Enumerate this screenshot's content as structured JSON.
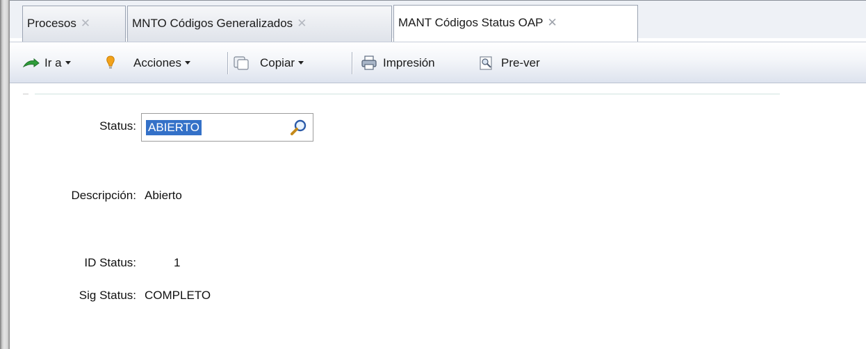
{
  "tabs": [
    {
      "label": "Procesos",
      "active": false
    },
    {
      "label": "MNTO Códigos Generalizados",
      "active": false
    },
    {
      "label": "MANT Códigos Status OAP",
      "active": true
    }
  ],
  "tab_close_glyph": "✕",
  "toolbar": {
    "goto_label": "Ir a",
    "actions_label": "Acciones",
    "copy_label": "Copiar",
    "print_label": "Impresión",
    "preview_label": "Pre-ver"
  },
  "form": {
    "status_label": "Status:",
    "status_value": "ABIERTO",
    "description_label": "Descripción:",
    "description_value": "Abierto",
    "id_status_label": "ID Status:",
    "id_status_value": "1",
    "next_status_label": "Sig Status:",
    "next_status_value": "COMPLETO"
  },
  "colors": {
    "selection": "#3471c8",
    "accent_green": "#2e9d3a",
    "accent_orange": "#f2a21b"
  },
  "icons": [
    "go-to-arrow-icon",
    "lightbulb-icon",
    "copy-icon",
    "printer-icon",
    "print-preview-icon",
    "magnifier-lookup-icon"
  ]
}
